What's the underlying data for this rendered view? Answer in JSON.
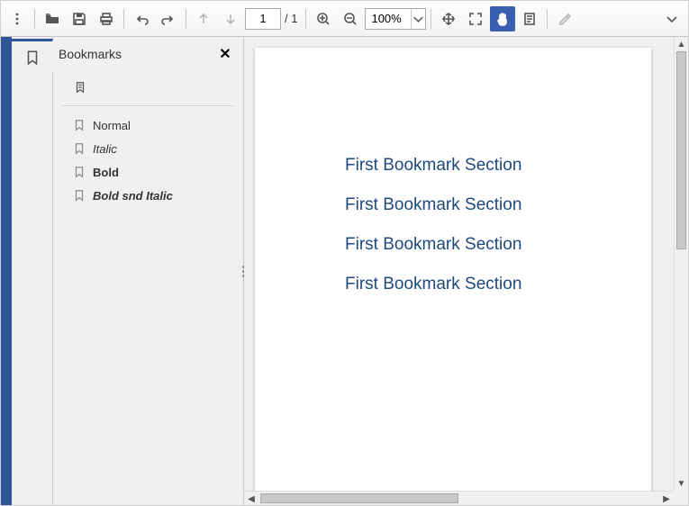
{
  "toolbar": {
    "page_current": "1",
    "page_total": "/ 1",
    "zoom": "100%"
  },
  "sidebar": {
    "title": "Bookmarks",
    "items": [
      {
        "label": "Normal",
        "style": "normal"
      },
      {
        "label": "Italic",
        "style": "italic"
      },
      {
        "label": "Bold",
        "style": "bold"
      },
      {
        "label": "Bold snd Italic",
        "style": "bolditalic"
      }
    ]
  },
  "document": {
    "lines": [
      "First Bookmark Section",
      "First Bookmark Section",
      "First Bookmark Section",
      "First Bookmark Section"
    ]
  }
}
